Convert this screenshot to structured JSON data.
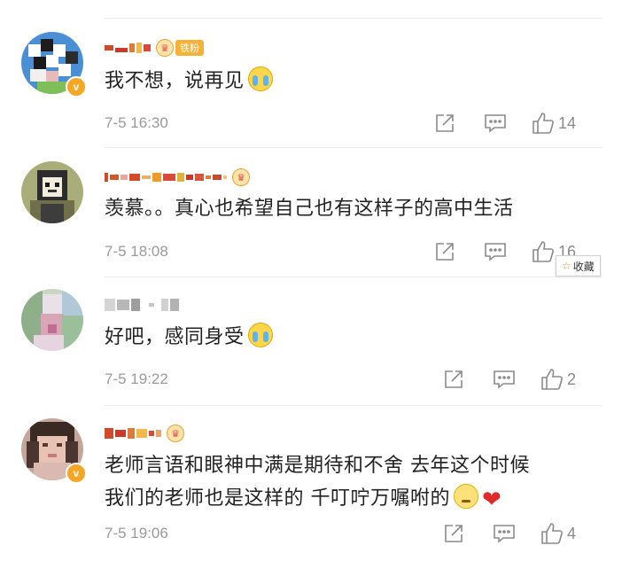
{
  "comments": [
    {
      "text": "我不想，说再见",
      "time": "7-5 16:30",
      "likes": "14",
      "fan_tag": "铁粉",
      "emoji": "crying-face-icon",
      "verified": true
    },
    {
      "text": "羡慕。。真心也希望自己也有这样子的高中生活",
      "time": "7-5 18:08",
      "likes": "16",
      "emoji": "",
      "verified": false
    },
    {
      "text": "好吧，感同身受",
      "time": "7-5 19:22",
      "likes": "2",
      "emoji": "crying-face-icon",
      "verified": false
    },
    {
      "text_line1": "老师言语和眼神中满是期待和不舍 去年这个时候",
      "text_line2": "我们的老师也是这样的 千叮咛万嘱咐的",
      "time": "7-5 19:06",
      "likes": "4",
      "emoji": "pouting-face-icon",
      "trailing_icon": "red-heart-icon",
      "verified": true
    }
  ],
  "tooltip": {
    "favorite_label": "收藏",
    "icon": "star-icon"
  },
  "colors": {
    "meta_gray": "#9a9a9a",
    "badge_orange": "#f5a623",
    "heart_red": "#e02a2a"
  }
}
